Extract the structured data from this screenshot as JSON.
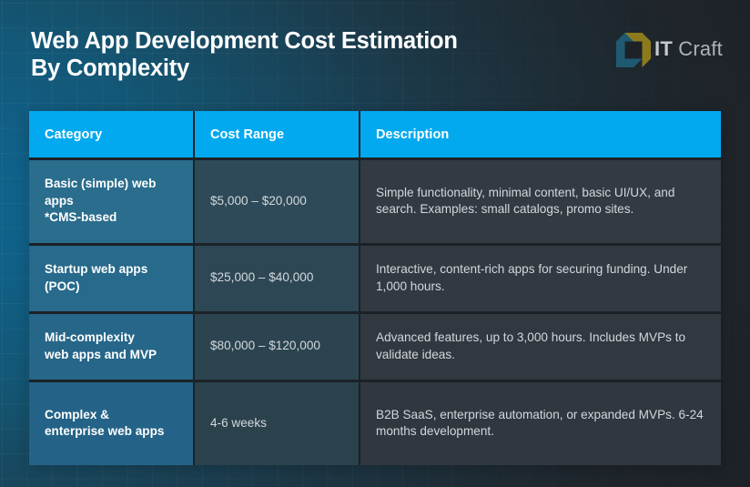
{
  "title": "Web App Development Cost Estimation\nBy Complexity",
  "colors": {
    "header_accent": "#03a9ef",
    "category_cell": "#26688a",
    "cost_cell": "#2d4552",
    "description_cell": "#333941",
    "background_blue": "#12688f",
    "background_dark": "#1d2127",
    "logo_gold": "#8d7a1d",
    "logo_teal": "#1f5a72",
    "logo_text": "#b9bdc2"
  },
  "logo": {
    "mark_name": "it-craft-cube-logo",
    "text_bold": "IT",
    "text_light": " Craft"
  },
  "table": {
    "columns": [
      "Category",
      "Cost Range",
      "Description"
    ],
    "rows": [
      {
        "category": "Basic (simple) web apps\n*CMS-based",
        "cost_range": "$5,000 – $20,000",
        "description": "Simple functionality, minimal content, basic UI/UX, and search. Examples: small catalogs, promo sites."
      },
      {
        "category": "Startup web apps\n(POC)",
        "cost_range": "$25,000 – $40,000",
        "description": "Interactive, content-rich apps for securing funding. Under 1,000 hours."
      },
      {
        "category": "Mid-complexity\nweb apps and MVP",
        "cost_range": "$80,000 – $120,000",
        "description": "Advanced features, up to 3,000 hours. Includes MVPs to validate ideas."
      },
      {
        "category": "Complex &\nenterprise web apps",
        "cost_range": "4-6 weeks",
        "description": "B2B SaaS, enterprise automation, or expanded MVPs. 6-24 months development."
      }
    ]
  }
}
